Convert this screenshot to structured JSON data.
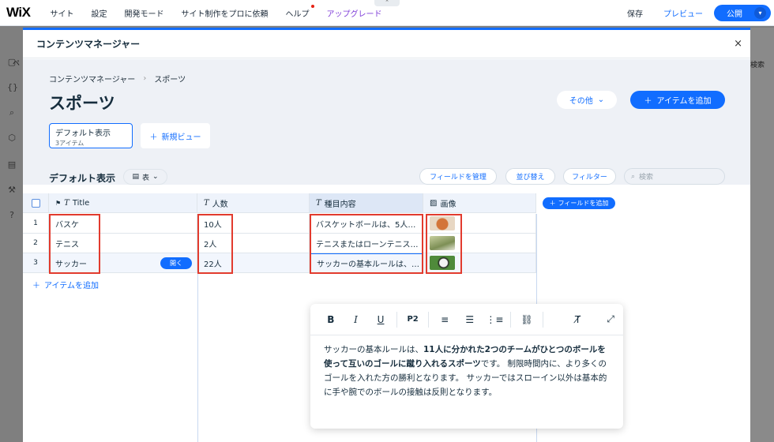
{
  "topbar": {
    "logo": "WiX",
    "nav": [
      "サイト",
      "設定",
      "開発モード",
      "サイト制作をプロに依頼",
      "ヘルプ",
      "アップグレード"
    ],
    "save": "保存",
    "preview": "プレビュー",
    "publish": "公開",
    "collapse_glyph": "⌃"
  },
  "underlay": {
    "left_text": "ペ",
    "right_text": "検索"
  },
  "modal": {
    "title": "コンテンツマネージャー",
    "close": "×",
    "breadcrumb": [
      "コンテンツマネージャー",
      "スポーツ"
    ],
    "page_title": "スポーツ",
    "more_label": "その他",
    "add_item_label": "アイテムを追加",
    "view_card": {
      "name": "デフォルト表示",
      "count": "3アイテム"
    },
    "new_view_label": "新規ビュー"
  },
  "toolbar": {
    "view_title": "デフォルト表示",
    "layout_label": "表",
    "manage_fields": "フィールドを管理",
    "sort": "並び替え",
    "filter": "フィルター",
    "search_placeholder": "検索"
  },
  "table": {
    "headers": {
      "title": "Title",
      "count": "人数",
      "desc": "種目内容",
      "image": "画像"
    },
    "rows": [
      {
        "num": "1",
        "title": "バスケ",
        "count": "10人",
        "desc": "バスケットボールは、5人…",
        "image_color": "#c9703a"
      },
      {
        "num": "2",
        "title": "テニス",
        "count": "2人",
        "desc": "テニスまたはローンテニス…",
        "image_color": "#9aa86a"
      },
      {
        "num": "3",
        "title": "サッカー",
        "count": "22人",
        "desc": "サッカーの基本ルールは、…",
        "image_color": "#4f8a3a"
      }
    ],
    "open_label": "開く",
    "add_field_label": "フィールドを追加",
    "add_item_row_label": "アイテムを追加"
  },
  "rte": {
    "tools": [
      "B",
      "I",
      "U",
      "P2"
    ],
    "text_before": "サッカーの基本ルールは、",
    "text_bold": "11人に分かれた2つのチームがひとつのボールを使って互いのゴールに蹴り入れるスポーツ",
    "text_after": "です。 制限時間内に、より多くのゴールを入れた方の勝利となります。 サッカーではスローイン以外は基本的に手や腕でのボールの接触は反則となります。"
  },
  "colors": {
    "accent": "#116dff",
    "highlight": "#e23b2e",
    "upgrade": "#7f3ed8"
  }
}
